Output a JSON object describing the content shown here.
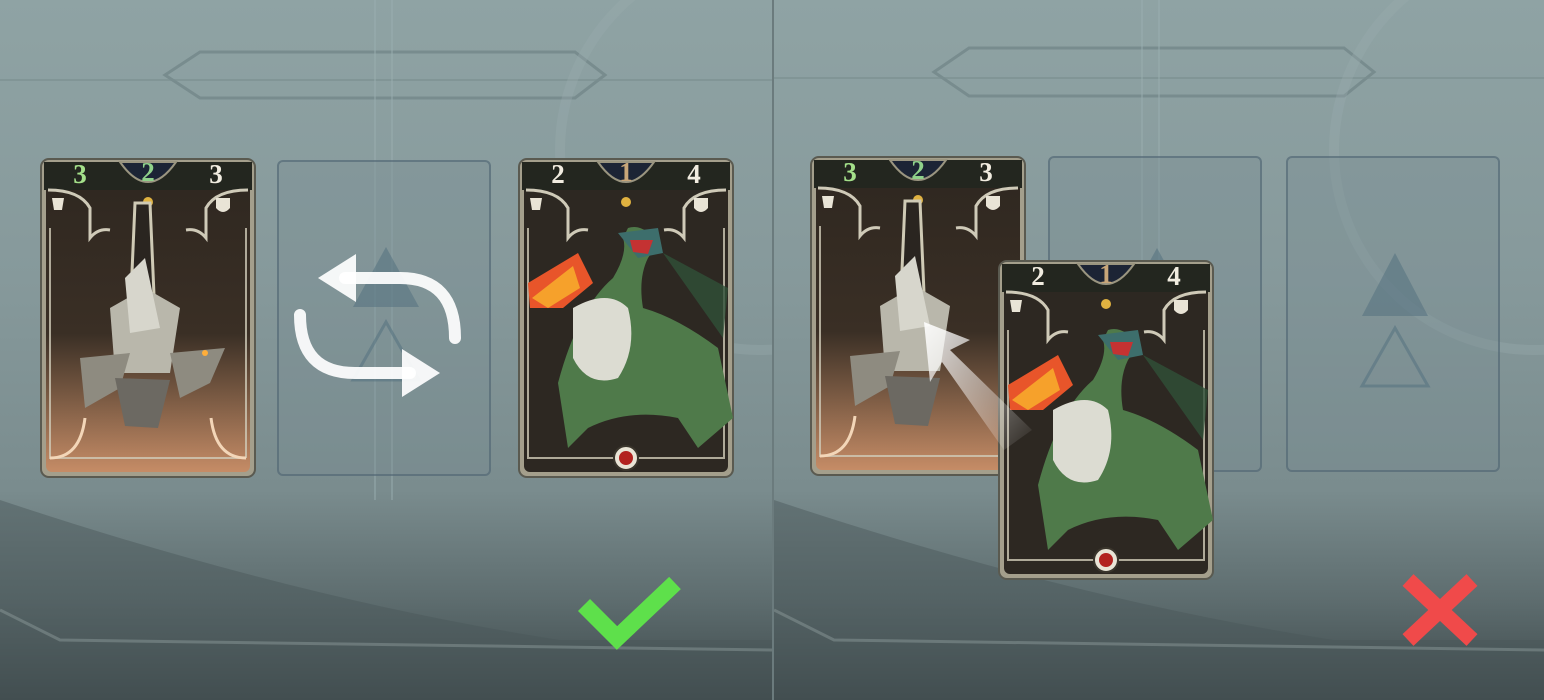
{
  "left_panel": {
    "card_a": {
      "attack": "3",
      "cost": "2",
      "health": "3",
      "icon": "spike-creature-art"
    },
    "card_b": {
      "attack": "2",
      "cost": "1",
      "health": "4",
      "icon": "wyvern-creature-art"
    },
    "indicator": "check-icon",
    "indicator_color": "#5ee04b"
  },
  "right_panel": {
    "card_a": {
      "attack": "3",
      "cost": "2",
      "health": "3",
      "icon": "spike-creature-art"
    },
    "card_b": {
      "attack": "2",
      "cost": "1",
      "health": "4",
      "icon": "wyvern-creature-art"
    },
    "indicator": "cross-icon",
    "indicator_color": "#f04a4a"
  },
  "colors": {
    "card_frame": "#cbc6b4",
    "card_inner": "#2d2822",
    "stat_bar": "#23261f",
    "empty_slot_border": "#48606e"
  }
}
